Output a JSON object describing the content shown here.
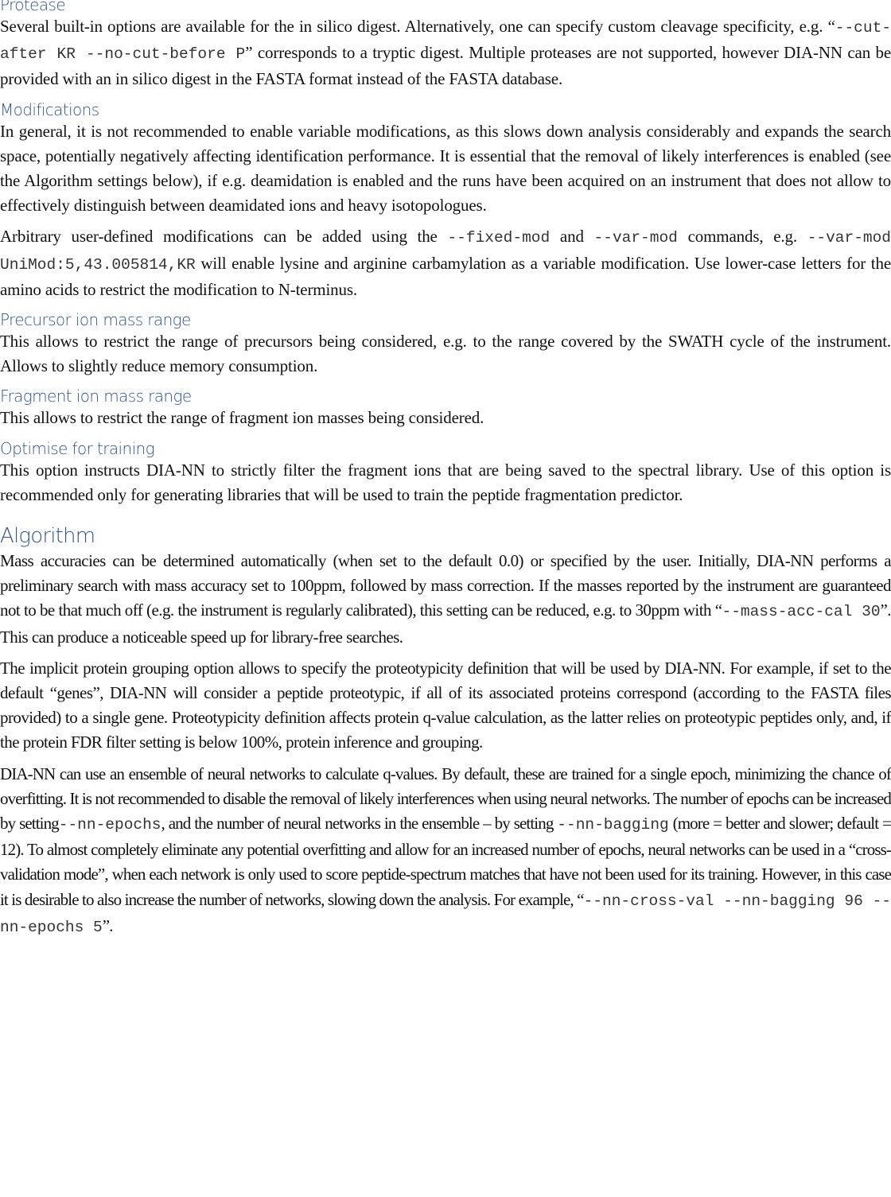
{
  "sections": {
    "protease": {
      "heading": "Protease",
      "p1": {
        "a": "Several built-in options are available for the in silico digest. Alternatively, one can specify custom cleavage specificity, e.g. “",
        "code": "--cut-after KR --no-cut-before P",
        "b": "” corresponds to a tryptic digest. Multiple proteases are not supported, however DIA-NN can be provided with an in silico digest in the FASTA format instead of the FASTA database."
      }
    },
    "modifications": {
      "heading": "Modifications",
      "p1": "In general, it is not recommended to enable variable modifications, as this slows down analysis considerably and expands the search space, potentially negatively affecting identification performance. It is essential that the removal of likely interferences is enabled (see the Algorithm settings below), if e.g. deamidation is enabled and the runs have been acquired on an instrument that does not allow to effectively distinguish between deamidated ions and heavy isotopologues.",
      "p2": {
        "a": "Arbitrary user-defined modifications can be added using the ",
        "code1": "--fixed-mod",
        "b": " and ",
        "code2": "--var-mod",
        "c": " commands, e.g. ",
        "code3": "--var-mod UniMod:5,43.005814,KR",
        "d": " will enable lysine and arginine carbamylation as a variable modification. Use lower-case letters for the amino acids to restrict the modification to N-terminus."
      }
    },
    "precursor": {
      "heading": "Precursor ion mass range",
      "p1": "This allows to restrict the range of precursors being considered, e.g. to the range covered by the SWATH cycle of the instrument. Allows to slightly reduce memory consumption."
    },
    "fragment": {
      "heading": "Fragment ion mass range",
      "p1": "This allows to restrict the range of fragment ion masses being considered."
    },
    "optimise": {
      "heading": "Optimise for training",
      "p1": "This option instructs DIA-NN to strictly filter the fragment ions that are being saved to the spectral library. Use of this option is recommended only for generating libraries that will be used to train the peptide fragmentation predictor."
    },
    "algorithm": {
      "heading": "Algorithm",
      "p1": {
        "a": "Mass accuracies can be determined automatically (when set to the default 0.0) or specified by the user. Initially, DIA-NN performs a preliminary search with mass accuracy set to 100ppm, followed by mass correction. If the masses reported by the instrument are guaranteed not to be that much off (e.g. the instrument is regularly calibrated), this setting can be reduced, e.g. to 30ppm with “",
        "code": "--mass-acc-cal 30",
        "b": "”. This can produce a noticeable speed up for library-free searches."
      },
      "p2": "The implicit protein grouping option allows to specify the proteotypicity definition that will be used by DIA-NN. For example, if set to the default “genes”, DIA-NN will consider a peptide proteotypic, if all of its associated proteins correspond (according to the FASTA files provided) to a single gene. Proteotypicity definition affects protein q-value calculation, as the latter relies on proteotypic peptides only, and, if the protein FDR filter setting is below 100%, protein inference and grouping.",
      "p3": {
        "a": "DIA-NN can use an ensemble of neural networks to calculate q-values. By default, these are trained for a single epoch, minimizing the chance of overfitting. It is not recommended to disable the removal of likely interferences when using neural networks. The number of epochs can be increased by setting",
        "code1": "--nn-epochs",
        "b": ", and the number of neural networks in the ensemble – by setting ",
        "code2": "--nn-bagging",
        "c": " (more = better and slower; default = 12). To almost completely eliminate any potential overfitting and allow for an increased number of epochs, neural networks can be used in a “cross-validation mode”, when each network is only used to score peptide-spectrum matches that have not been used for its training. However, in this case it is desirable to also increase the number of networks, slowing down the analysis. For example, “",
        "code3": "--nn-cross-val --nn-bagging 96 --nn-epochs 5",
        "d": "”."
      }
    }
  },
  "colors": {
    "heading": "#2f5496",
    "text": "#111111"
  }
}
